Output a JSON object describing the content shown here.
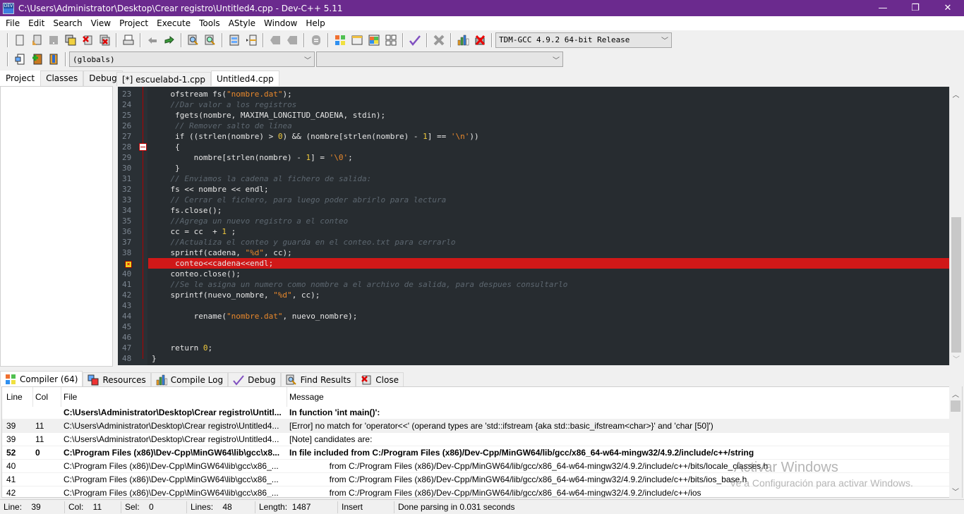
{
  "window": {
    "title": "C:\\Users\\Administrator\\Desktop\\Crear registro\\Untitled4.cpp - Dev-C++ 5.11",
    "controls": {
      "minimize": "—",
      "maximize": "❐",
      "close": "✕"
    }
  },
  "menu": [
    "File",
    "Edit",
    "Search",
    "View",
    "Project",
    "Execute",
    "Tools",
    "AStyle",
    "Window",
    "Help"
  ],
  "toolbar": {
    "compiler_select": "TDM-GCC 4.9.2 64-bit Release",
    "scope_select": "(globals)",
    "function_select": ""
  },
  "left_tabs": [
    "Project",
    "Classes",
    "Debug"
  ],
  "editor_tabs": [
    "[*] escuelabd-1.cpp",
    "Untitled4.cpp"
  ],
  "editor": {
    "lines": [
      {
        "n": "23",
        "html": "    ofstream fs(<span class='str'>\"nombre.dat\"</span>);"
      },
      {
        "n": "24",
        "html": "    <span class='cmt'>//Dar valor a los registros</span>"
      },
      {
        "n": "25",
        "html": "     fgets(nombre, MAXIMA_LONGITUD_CADENA, stdin);"
      },
      {
        "n": "26",
        "html": "     <span class='cmt'>// Remover salto de línea</span>"
      },
      {
        "n": "27",
        "html": "     if ((strlen(nombre) &gt; <span class='num'>0</span>) &amp;&amp; (nombre[strlen(nombre) - <span class='num'>1</span>] == <span class='str'>'\\n'</span>))"
      },
      {
        "n": "28",
        "html": "     {"
      },
      {
        "n": "29",
        "html": "         nombre[strlen(nombre) - <span class='num'>1</span>] = <span class='str'>'\\0'</span>;"
      },
      {
        "n": "30",
        "html": "     }"
      },
      {
        "n": "31",
        "html": "    <span class='cmt'>// Enviamos la cadena al fichero de salida:</span>"
      },
      {
        "n": "32",
        "html": "    fs &lt;&lt; nombre &lt;&lt; endl;"
      },
      {
        "n": "33",
        "html": "    <span class='cmt'>// Cerrar el fichero, para luego poder abrirlo para lectura</span>"
      },
      {
        "n": "34",
        "html": "    fs.close();"
      },
      {
        "n": "35",
        "html": "    <span class='cmt'>//Agrega un nuevo registro a el conteo</span>"
      },
      {
        "n": "36",
        "html": "    cc = cc  + <span class='num'>1</span> ;"
      },
      {
        "n": "37",
        "html": "    <span class='cmt'>//Actualiza el conteo y guarda en el conteo.txt para cerrarlo</span>"
      },
      {
        "n": "38",
        "html": "    sprintf(cadena, <span class='str'>\"%d\"</span>, cc);"
      },
      {
        "n": "39",
        "html": "     conteo&lt;&lt;cadena&lt;&lt;endl;",
        "error": true
      },
      {
        "n": "40",
        "html": "    conteo.close();"
      },
      {
        "n": "41",
        "html": "    <span class='cmt'>//Se le asigna un numero como nombre a el archivo de salida, para despues consultarlo</span>"
      },
      {
        "n": "42",
        "html": "    sprintf(nuevo_nombre, <span class='str'>\"%d\"</span>, cc);"
      },
      {
        "n": "43",
        "html": ""
      },
      {
        "n": "44",
        "html": "         rename(<span class='str'>\"nombre.dat\"</span>, nuevo_nombre);"
      },
      {
        "n": "45",
        "html": ""
      },
      {
        "n": "46",
        "html": ""
      },
      {
        "n": "47",
        "html": "    return <span class='num'>0</span>;"
      },
      {
        "n": "48",
        "html": "}"
      }
    ],
    "error_color": "#d01818",
    "background": "#272c30"
  },
  "bottom_tabs": [
    "Compiler (64)",
    "Resources",
    "Compile Log",
    "Debug",
    "Find Results",
    "Close"
  ],
  "compiler": {
    "headers": [
      "Line",
      "Col",
      "File",
      "Message"
    ],
    "rows": [
      {
        "line": "",
        "col": "",
        "file": "C:\\Users\\Administrator\\Desktop\\Crear registro\\Untitl...",
        "msg": "In function 'int main()':",
        "bold": true
      },
      {
        "line": "39",
        "col": "11",
        "file": "C:\\Users\\Administrator\\Desktop\\Crear registro\\Untitled4...",
        "msg": "[Error] no match for 'operator<<' (operand types are 'std::ifstream {aka std::basic_ifstream<char>}' and 'char [50]')",
        "selected": true
      },
      {
        "line": "39",
        "col": "11",
        "file": "C:\\Users\\Administrator\\Desktop\\Crear registro\\Untitled4...",
        "msg": "[Note] candidates are:"
      },
      {
        "line": "52",
        "col": "0",
        "file": "C:\\Program Files (x86)\\Dev-Cpp\\MinGW64\\lib\\gcc\\x8...",
        "msg": "In file included from C:/Program Files (x86)/Dev-Cpp/MinGW64/lib/gcc/x86_64-w64-mingw32/4.9.2/include/c++/string",
        "bold": true
      },
      {
        "line": "40",
        "col": "",
        "file": "C:\\Program Files (x86)\\Dev-Cpp\\MinGW64\\lib\\gcc\\x86_...",
        "msg": "                 from C:/Program Files (x86)/Dev-Cpp/MinGW64/lib/gcc/x86_64-w64-mingw32/4.9.2/include/c++/bits/locale_classes.h"
      },
      {
        "line": "41",
        "col": "",
        "file": "C:\\Program Files (x86)\\Dev-Cpp\\MinGW64\\lib\\gcc\\x86_...",
        "msg": "                 from C:/Program Files (x86)/Dev-Cpp/MinGW64/lib/gcc/x86_64-w64-mingw32/4.9.2/include/c++/bits/ios_base.h"
      },
      {
        "line": "42",
        "col": "",
        "file": "C:\\Program Files (x86)\\Dev-Cpp\\MinGW64\\lib\\gcc\\x86_...",
        "msg": "                 from C:/Program Files (x86)/Dev-Cpp/MinGW64/lib/gcc/x86_64-w64-mingw32/4.9.2/include/c++/ios"
      }
    ]
  },
  "watermark": {
    "line1": "Activar Windows",
    "line2": "Ve a Configuración para activar Windows."
  },
  "status": {
    "line": "Line:    39",
    "col": "Col:    11",
    "sel": "Sel:    0",
    "lines": "Lines:    48",
    "length": "Length:  1487",
    "mode": "Insert",
    "message": "Done parsing in 0.031 seconds"
  }
}
